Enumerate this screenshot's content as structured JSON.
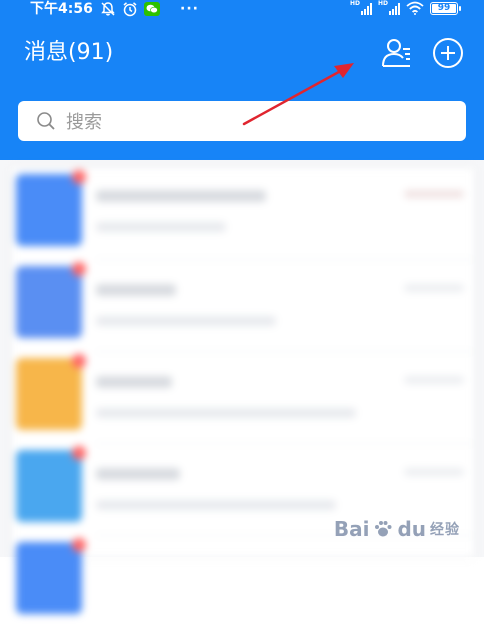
{
  "status_bar": {
    "time": "下午4:56",
    "more": "···",
    "battery": "99"
  },
  "header": {
    "title": "消息(91)"
  },
  "search": {
    "placeholder": "搜索"
  },
  "colors": {
    "header_bg": "#1784f7",
    "annotation_arrow": "#e0252f",
    "avatar_1": "#4a8cf7",
    "avatar_2": "#5a8ff2",
    "avatar_3": "#f7b64a",
    "avatar_4": "#4aa7ef",
    "avatar_5": "#4a8cf7"
  },
  "watermark": {
    "brand": "Bai",
    "brand2": "du",
    "sub": "经验"
  }
}
